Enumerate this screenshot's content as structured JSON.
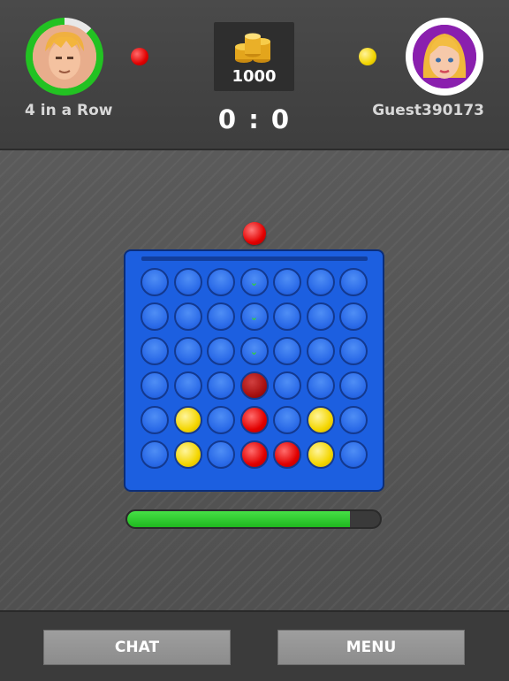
{
  "players": {
    "left": {
      "name": "4 in a Row",
      "piece_color": "#e00000",
      "timer_ring_color": "#22c222"
    },
    "right": {
      "name": "Guest390173",
      "piece_color": "#f2d400"
    }
  },
  "coins": {
    "amount": "1000",
    "icon": "coin-stack-icon"
  },
  "score": {
    "text": "0 : 0"
  },
  "current_drop_piece": "red",
  "board": {
    "rows": 6,
    "cols": 7,
    "grid": [
      [
        "empty",
        "empty",
        "empty",
        "hint",
        "empty",
        "empty",
        "empty"
      ],
      [
        "empty",
        "empty",
        "empty",
        "hint",
        "empty",
        "empty",
        "empty"
      ],
      [
        "empty",
        "empty",
        "empty",
        "hint",
        "empty",
        "empty",
        "empty"
      ],
      [
        "empty",
        "empty",
        "empty",
        "ghost",
        "empty",
        "empty",
        "empty"
      ],
      [
        "empty",
        "yellow",
        "empty",
        "red",
        "empty",
        "yellow",
        "empty"
      ],
      [
        "empty",
        "yellow",
        "empty",
        "red",
        "red",
        "yellow",
        "empty"
      ]
    ],
    "hint_glyph": "⌄"
  },
  "turn_timer": {
    "remaining_fraction": 0.88
  },
  "buttons": {
    "chat": "CHAT",
    "menu": "MENU"
  }
}
